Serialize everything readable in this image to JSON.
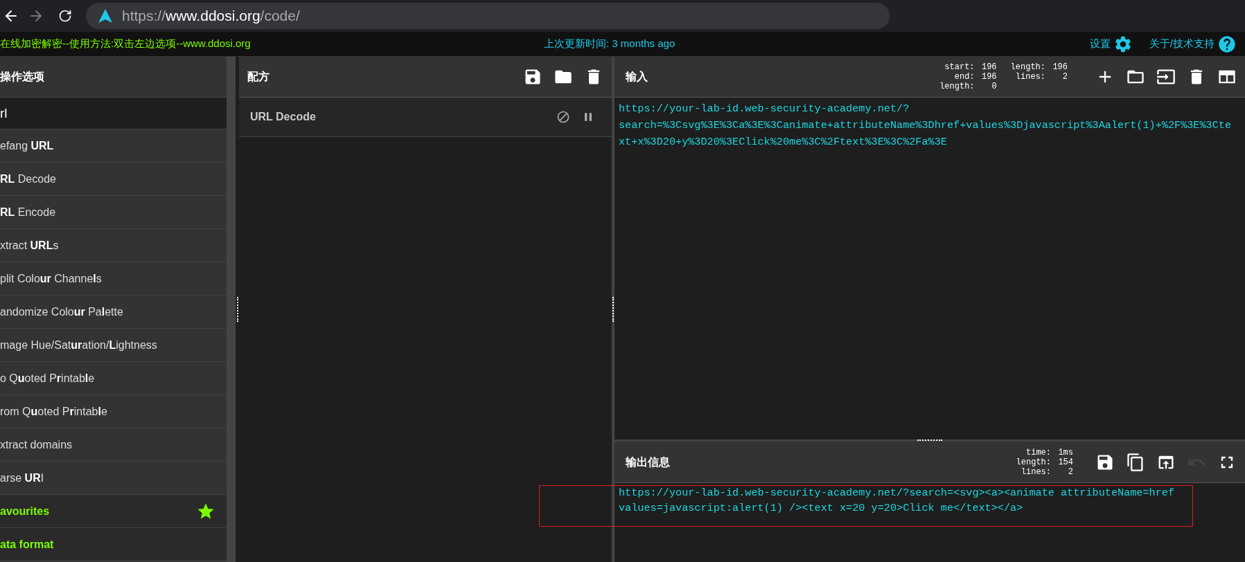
{
  "browser": {
    "url": "https://**www.ddosi.org**/code/"
  },
  "banner": {
    "left": "在线加密解密--使用方法:双击左边选项--www.ddosi.org",
    "center": "上次更新时间: 3 months ago",
    "settings": "设置",
    "about": "关于/技术支持"
  },
  "operations": {
    "title": "操作选项",
    "search": "rl",
    "items": [
      {
        "kind": "operation",
        "label": "efang **URL**"
      },
      {
        "kind": "operation",
        "label": "**RL** Decode"
      },
      {
        "kind": "operation",
        "label": "**RL** Encode"
      },
      {
        "kind": "operation",
        "label": "xtract **URL**s"
      },
      {
        "kind": "operation",
        "label": "plit Colo**ur** Channe**l**s"
      },
      {
        "kind": "operation",
        "label": "andomize Colo**ur** Pa**l**ette"
      },
      {
        "kind": "operation",
        "label": "mage Hue/Sat**ur**ation/**L**ightness"
      },
      {
        "kind": "operation",
        "label": "o Q**u**oted P**r**intab**l**e"
      },
      {
        "kind": "operation",
        "label": "rom Q**u**oted P**r**intab**l**e"
      },
      {
        "kind": "operation",
        "label": "xtract domains"
      },
      {
        "kind": "operation",
        "label": "arse **UR**I"
      },
      {
        "kind": "favourites",
        "label": "avourites"
      },
      {
        "kind": "category",
        "label": "ata format"
      }
    ]
  },
  "recipe": {
    "title": "配方",
    "ops": [
      {
        "name": "URL Decode"
      }
    ]
  },
  "input": {
    "title": "输入",
    "stats": [
      [
        {
          "label": "start:",
          "value": "196"
        },
        {
          "label": "end:",
          "value": "196"
        },
        {
          "label": "length:",
          "value": "0"
        }
      ],
      [
        {
          "label": "length:",
          "value": "196"
        },
        {
          "label": "lines:",
          "value": "2"
        }
      ]
    ],
    "lines": [
      "https://your-lab-id.web-security-academy.net/?",
      "search=%3Csvg%3E%3Ca%3E%3Canimate+attributeName%3Dhref+values%3Djavascript%3Aalert(1)+%2F%3E%3Cte",
      "xt+x%3D20+y%3D20%3EClick%20me%3C%2Ftext%3E%3C%2Fa%3E"
    ]
  },
  "output": {
    "title": "输出信息",
    "stats": [
      {
        "label": "time:",
        "value": "1ms"
      },
      {
        "label": "length:",
        "value": "154"
      },
      {
        "label": "lines:",
        "value": "2"
      }
    ],
    "undo": {
      "disabled": true
    },
    "lines": [
      "https://your-lab-id.web-security-academy.net/?search=<svg><a><animate attributeName=href",
      "values=javascript:alert(1) /><text x=20 y=20>Click me</text></a>"
    ]
  }
}
